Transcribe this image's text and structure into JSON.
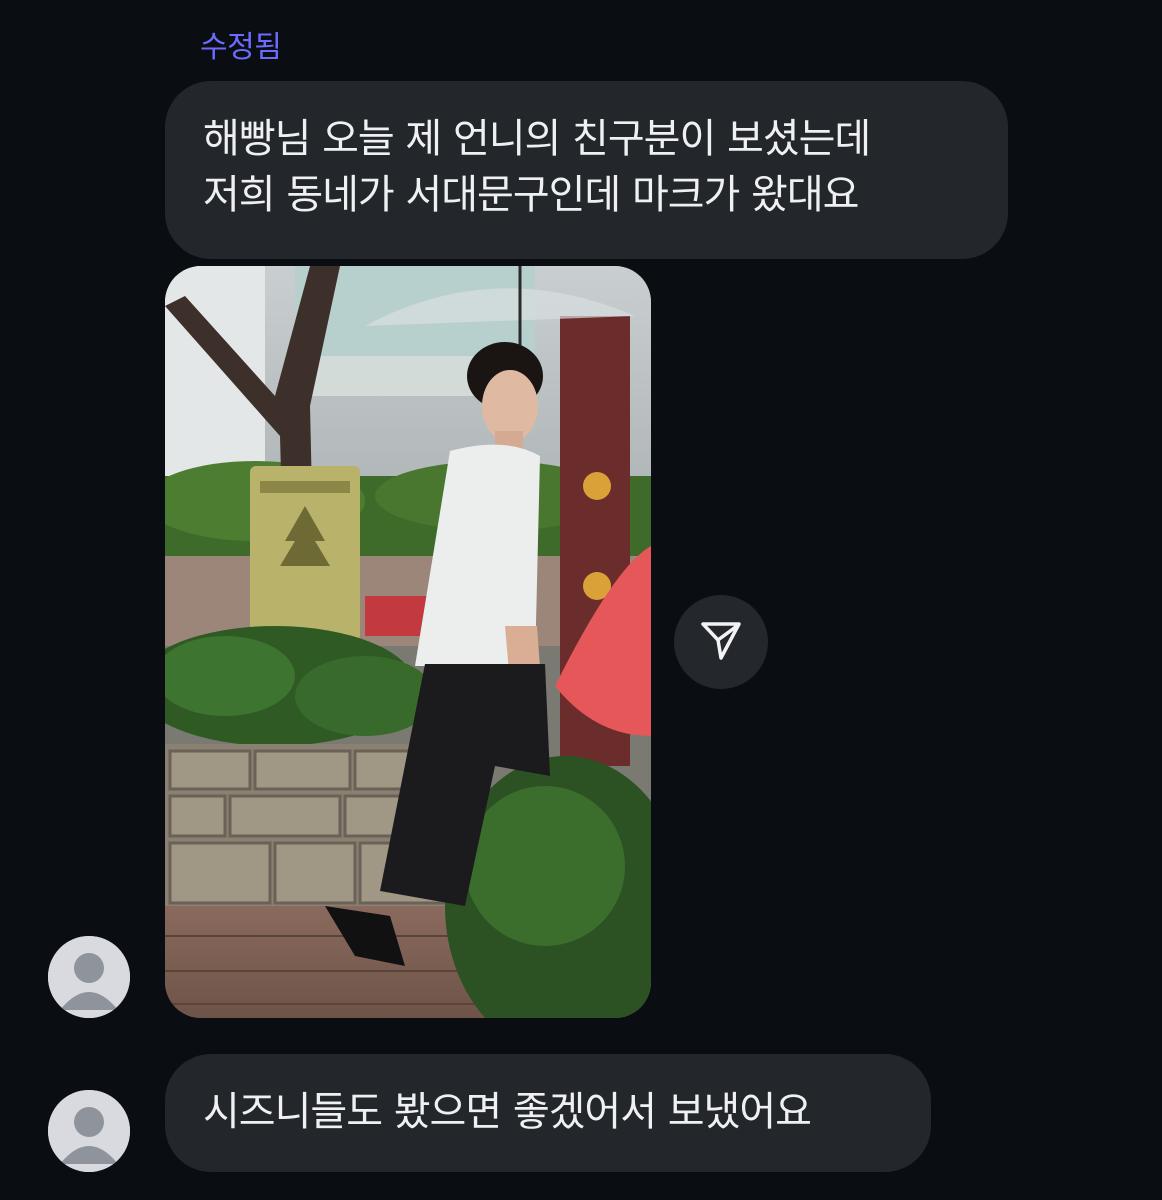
{
  "conversation": {
    "edited_label": "수정됨",
    "messages": [
      {
        "lines": [
          "해빵님 오늘 제 언니의 친구분이 보셨는데",
          "저희 동네가 서대문구인데 마크가 왔대요"
        ]
      },
      {
        "type": "photo",
        "description_icon": "photo"
      },
      {
        "text": "시즈니들도 봤으면 좋겠어서 보냈어요"
      }
    ],
    "share_icon": "paper-plane-icon",
    "avatar_icon": "default-user-icon"
  },
  "colors": {
    "background": "#0a0d12",
    "bubble": "#23262b",
    "edited": "#6b6bff",
    "text": "#eef0f2"
  }
}
